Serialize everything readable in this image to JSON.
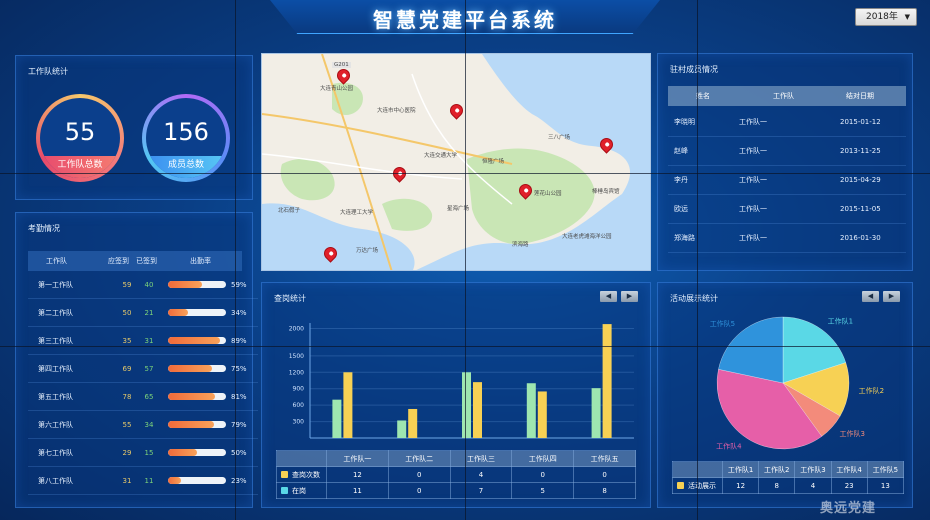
{
  "header": {
    "title": "智慧党建平台系统",
    "year": "2018年"
  },
  "team_stats": {
    "title": "工作队统计",
    "team_count": "55",
    "team_label": "工作队总数",
    "member_count": "156",
    "member_label": "成员总数"
  },
  "attendance": {
    "title": "考勤情况",
    "headers": [
      "工作队",
      "应签到",
      "已签到",
      "出勤率"
    ],
    "rows": [
      {
        "team": "第一工作队",
        "due": "59",
        "signed": "40",
        "rate": 0.59,
        "rate_label": "59%"
      },
      {
        "team": "第二工作队",
        "due": "50",
        "signed": "21",
        "rate": 0.34,
        "rate_label": "34%"
      },
      {
        "team": "第三工作队",
        "due": "35",
        "signed": "31",
        "rate": 0.89,
        "rate_label": "89%"
      },
      {
        "team": "第四工作队",
        "due": "69",
        "signed": "57",
        "rate": 0.75,
        "rate_label": "75%"
      },
      {
        "team": "第五工作队",
        "due": "78",
        "signed": "65",
        "rate": 0.81,
        "rate_label": "81%"
      },
      {
        "team": "第六工作队",
        "due": "55",
        "signed": "34",
        "rate": 0.79,
        "rate_label": "79%"
      },
      {
        "team": "第七工作队",
        "due": "29",
        "signed": "15",
        "rate": 0.5,
        "rate_label": "50%"
      },
      {
        "team": "第八工作队",
        "due": "31",
        "signed": "11",
        "rate": 0.23,
        "rate_label": "23%"
      }
    ]
  },
  "members": {
    "title": "驻村成员情况",
    "headers": [
      "姓名",
      "工作队",
      "结对日期"
    ],
    "rows": [
      {
        "name": "李晓明",
        "team": "工作队一",
        "date": "2015-01-12"
      },
      {
        "name": "赵峰",
        "team": "工作队一",
        "date": "2013-11-25"
      },
      {
        "name": "李丹",
        "team": "工作队一",
        "date": "2015-04-29"
      },
      {
        "name": "欧远",
        "team": "工作队一",
        "date": "2015-11-05"
      },
      {
        "name": "郑海路",
        "team": "工作队一",
        "date": "2016-01-30"
      }
    ]
  },
  "map": {
    "labels": [
      "大连青山公园",
      "大连市中心医院",
      "大连交通大学",
      "恒隆广场",
      "三八广场",
      "大连理工大学",
      "星海广场",
      "万达广场",
      "北石假子",
      "棒棰岛宾馆",
      "莲花山公园",
      "大连老虎滩海洋公园",
      "滨海路",
      "G201"
    ]
  },
  "check_chart": {
    "title": "查岗统计",
    "arrow_left": "◀",
    "arrow_right": "▶",
    "legend_checks": "查岗次数",
    "legend_present": "在岗",
    "check_color": "#f7d154",
    "present_color": "#9ee6b0"
  },
  "activity_chart": {
    "title": "活动展示统计",
    "arrow_left": "◀",
    "arrow_right": "▶",
    "legend_label": "活动展示",
    "legend_color": "#f7d154"
  },
  "chart_data": [
    {
      "type": "bar",
      "title": "查岗统计",
      "categories": [
        "工作队一",
        "工作队二",
        "工作队三",
        "工作队四",
        "工作队五"
      ],
      "yticks": [
        300,
        600,
        900,
        1200,
        1500,
        2000
      ],
      "ylim": [
        0,
        2100
      ],
      "series": [
        {
          "name": "在岗",
          "values": [
            700,
            320,
            1200,
            1000,
            910
          ],
          "color": "#9ee6b0"
        },
        {
          "name": "查岗次数",
          "values": [
            1200,
            530,
            1020,
            850,
            2080
          ],
          "color": "#f7d154"
        }
      ],
      "table": {
        "查岗次数": [
          "12",
          "0",
          "4",
          "0",
          "0"
        ],
        "在岗": [
          "11",
          "0",
          "7",
          "5",
          "8"
        ]
      }
    },
    {
      "type": "pie",
      "title": "活动展示统计",
      "categories": [
        "工作队1",
        "工作队2",
        "工作队3",
        "工作队4",
        "工作队5"
      ],
      "values": [
        12,
        8,
        4,
        23,
        13
      ],
      "colors": [
        "#5ad8e6",
        "#f7d154",
        "#f38b7b",
        "#e65fa8",
        "#2f93dc"
      ],
      "table_values": [
        "12",
        "8",
        "4",
        "23",
        "13"
      ]
    }
  ],
  "watermark": "奥远党建"
}
